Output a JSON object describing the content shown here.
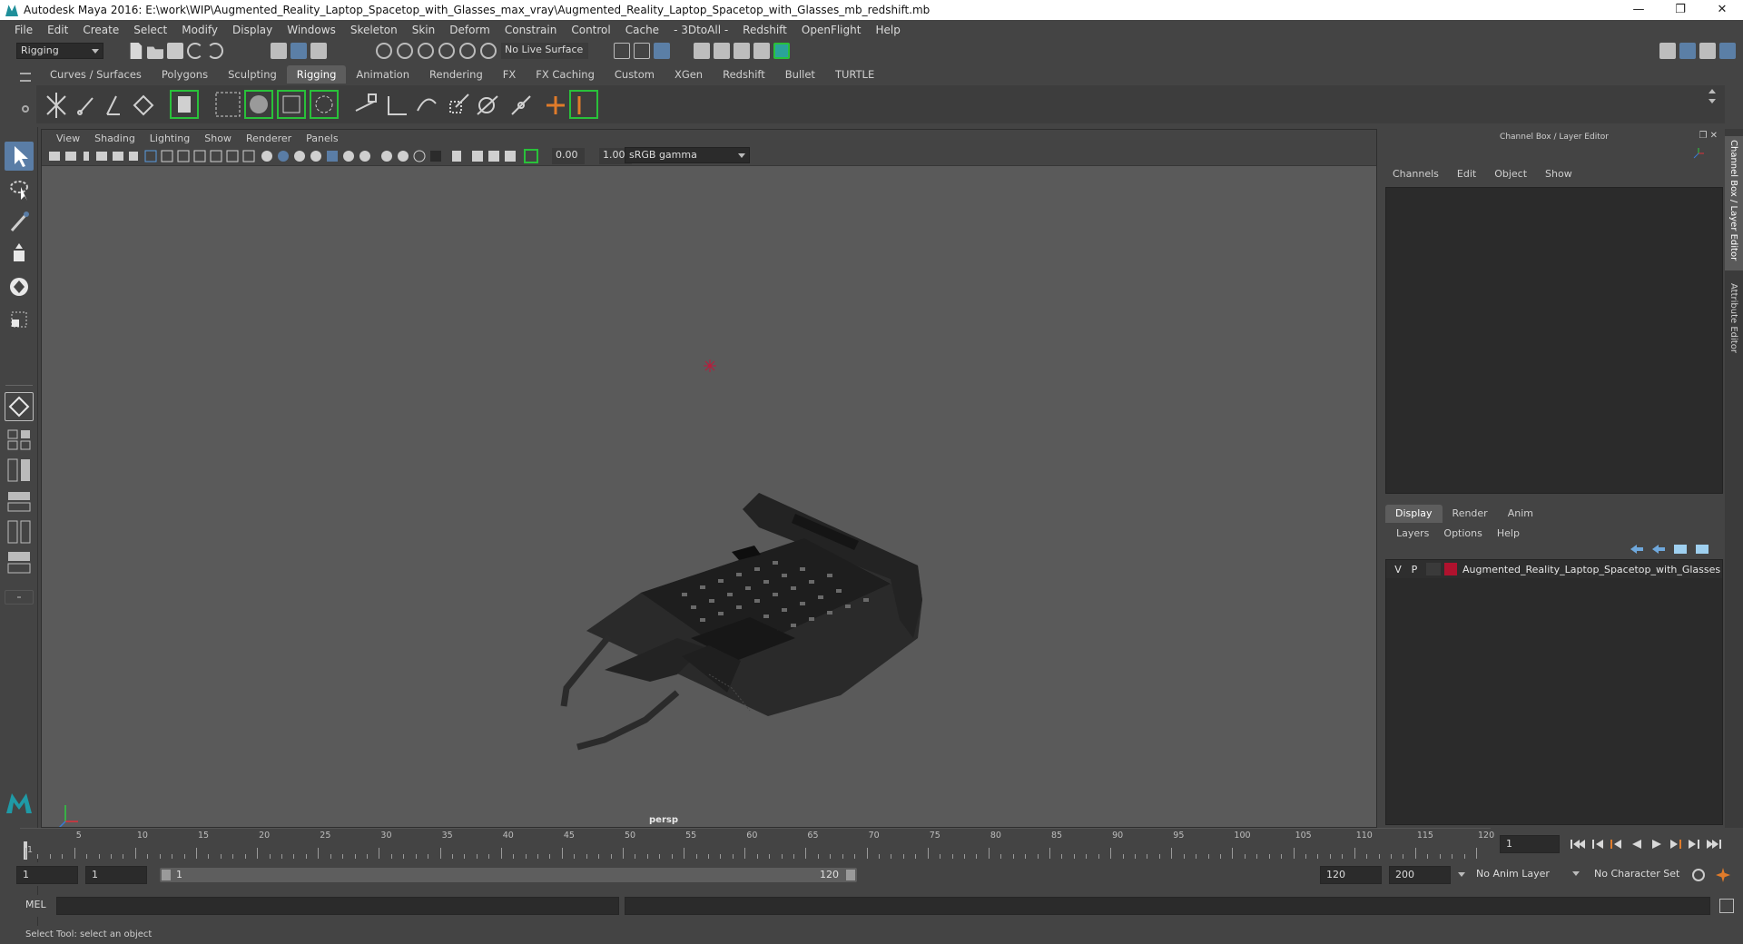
{
  "titlebar": {
    "title": "Autodesk Maya 2016: E:\\work\\WIP\\Augmented_Reality_Laptop_Spacetop_with_Glasses_max_vray\\Augmented_Reality_Laptop_Spacetop_with_Glasses_mb_redshift.mb",
    "minimize": "—",
    "restore": "❐",
    "close": "✕"
  },
  "menubar": [
    "File",
    "Edit",
    "Create",
    "Select",
    "Modify",
    "Display",
    "Windows",
    "Skeleton",
    "Skin",
    "Deform",
    "Constrain",
    "Control",
    "Cache",
    "- 3DtoAll -",
    "Redshift",
    "OpenFlight",
    "Help"
  ],
  "statusline": {
    "mode": "Rigging",
    "live_surface": "No Live Surface"
  },
  "shelf_tabs": [
    "Curves / Surfaces",
    "Polygons",
    "Sculpting",
    "Rigging",
    "Animation",
    "Rendering",
    "FX",
    "FX Caching",
    "Custom",
    "XGen",
    "Redshift",
    "Bullet",
    "TURTLE"
  ],
  "shelf_active": "Rigging",
  "viewport": {
    "menu": [
      "View",
      "Shading",
      "Lighting",
      "Show",
      "Renderer",
      "Panels"
    ],
    "exposure": "0.00",
    "gamma": "1.00",
    "color_space": "sRGB gamma",
    "camera": "persp"
  },
  "channel_box": {
    "title": "Channel Box / Layer Editor",
    "menu": [
      "Channels",
      "Edit",
      "Object",
      "Show"
    ]
  },
  "layer_editor": {
    "tabs": [
      "Display",
      "Render",
      "Anim"
    ],
    "active_tab": "Display",
    "menu": [
      "Layers",
      "Options",
      "Help"
    ],
    "layers": [
      {
        "v": "V",
        "p": "P",
        "color": "#b0122e",
        "name": "Augmented_Reality_Laptop_Spacetop_with_Glasses"
      }
    ]
  },
  "side_tabs": [
    "Channel Box / Layer Editor",
    "Attribute Editor"
  ],
  "timeline": {
    "ticks": [
      "1",
      "5",
      "10",
      "15",
      "20",
      "25",
      "30",
      "35",
      "40",
      "45",
      "50",
      "55",
      "60",
      "65",
      "70",
      "75",
      "80",
      "85",
      "90",
      "95",
      "100",
      "105",
      "110",
      "115",
      "120"
    ],
    "current_frame": "1"
  },
  "range": {
    "start": "1",
    "anim_start": "1",
    "slider_start": "1",
    "slider_end": "120",
    "end": "120",
    "anim_end": "200",
    "anim_layer": "No Anim Layer",
    "character_set": "No Character Set"
  },
  "command": {
    "label": "MEL"
  },
  "helpline": "Select Tool: select an object",
  "colors": {
    "accent": "#5d5d5d",
    "layer_color": "#b0122e",
    "highlight_green": "#29c13a"
  }
}
